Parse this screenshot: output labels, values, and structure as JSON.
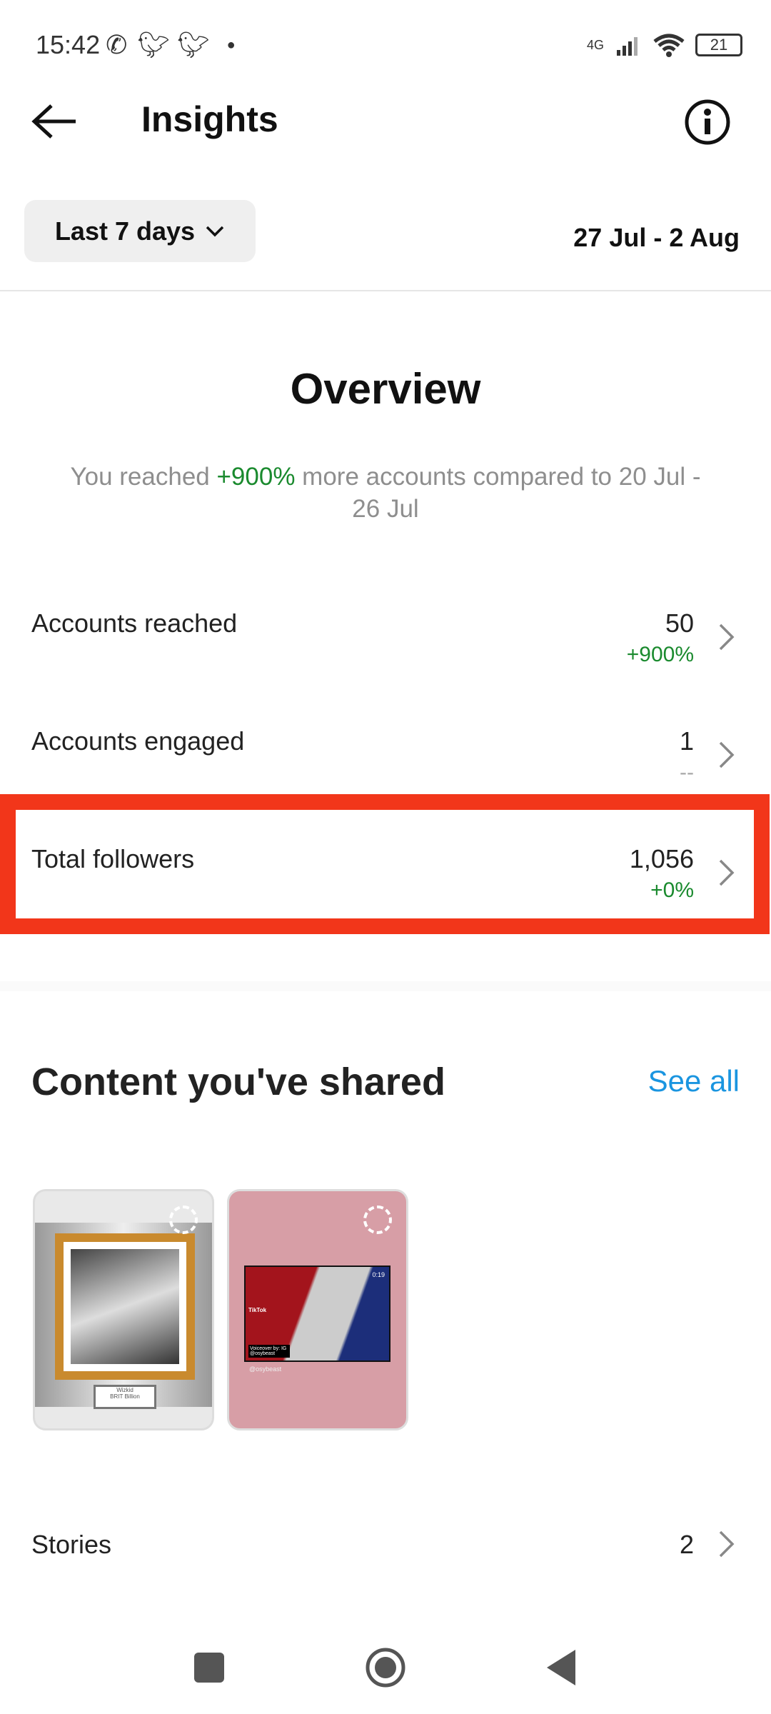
{
  "status_bar": {
    "time": "15:42",
    "network": "4G",
    "battery": "21",
    "icons": [
      "whatsapp-icon",
      "twitter-icon",
      "twitter-icon",
      "dot-icon",
      "signal-icon",
      "wifi-icon",
      "battery-icon"
    ]
  },
  "header": {
    "title": "Insights",
    "back_icon": "arrow-left-icon",
    "info_icon": "info-icon"
  },
  "filter": {
    "range_label": "Last 7 days",
    "date_range": "27 Jul - 2 Aug"
  },
  "overview": {
    "title": "Overview",
    "summary_prefix": "You reached ",
    "summary_highlight": "+900%",
    "summary_suffix": " more accounts compared to 20 Jul - 26 Jul",
    "metrics": [
      {
        "label": "Accounts reached",
        "value": "50",
        "change": "+900%"
      },
      {
        "label": "Accounts engaged",
        "value": "1",
        "change": "--"
      },
      {
        "label": "Total followers",
        "value": "1,056",
        "change": "+0%"
      }
    ]
  },
  "highlight_color": "#f2361a",
  "content": {
    "title": "Content you've shared",
    "see_all": "See all",
    "thumbs": [
      {
        "caption": "Wizkid",
        "sub": "BRIT Billion"
      },
      {
        "duration": "0:19",
        "brand": "TikTok",
        "voiceover": "Voiceover by: IG @osybeast",
        "handle": "@osybeast"
      }
    ],
    "stories_label": "Stories",
    "stories_count": "2"
  },
  "colors": {
    "positive": "#1a8a2e",
    "link": "#1a95e0"
  }
}
